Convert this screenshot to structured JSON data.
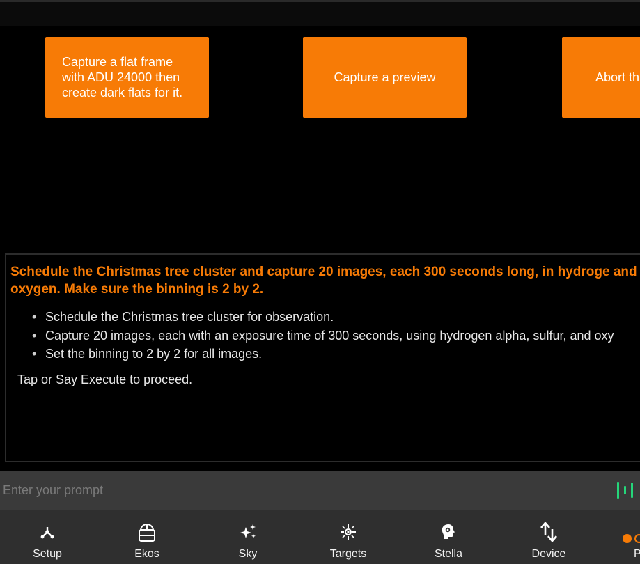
{
  "suggestions": [
    {
      "label": "Capture a flat frame with ADU 24000 then create dark flats for it."
    },
    {
      "label": "Capture a preview"
    },
    {
      "label": "Abort th"
    }
  ],
  "response": {
    "title": "Schedule the Christmas tree cluster and capture 20 images, each 300 seconds long, in hydroge and oxygen. Make sure the binning is 2 by 2.",
    "items": [
      "Schedule the Christmas tree cluster for observation.",
      "Capture 20 images, each with an exposure time of 300 seconds, using hydrogen alpha, sulfur, and oxy",
      "Set the binning to 2 by 2 for all images."
    ],
    "footer": "Tap or Say Execute to proceed."
  },
  "prompt": {
    "placeholder": "Enter your prompt",
    "value": "",
    "mic_icon": "voice-wave-icon"
  },
  "nav": {
    "items": [
      {
        "label": "Setup",
        "icon": "setup-icon"
      },
      {
        "label": "Ekos",
        "icon": "ekos-icon"
      },
      {
        "label": "Sky",
        "icon": "sky-sparkle-icon"
      },
      {
        "label": "Targets",
        "icon": "targets-icon"
      },
      {
        "label": "Stella",
        "icon": "stella-head-icon"
      },
      {
        "label": "Device",
        "icon": "device-arrows-icon"
      }
    ],
    "partial_label": "P"
  },
  "colors": {
    "accent": "#f77b06",
    "mic": "#25d67a",
    "background": "#000000",
    "nav_bg": "#2f2f2f",
    "prompt_bg": "#3a3a3a"
  }
}
